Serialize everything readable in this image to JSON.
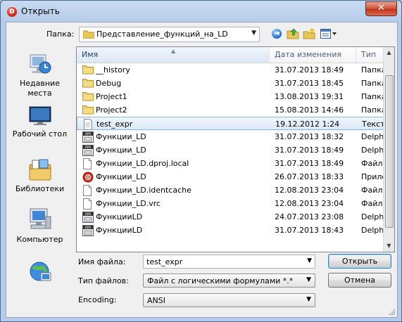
{
  "window": {
    "title": "Открыть",
    "close_glyph": "✕",
    "app_icon_letter": "D"
  },
  "toolbar": {
    "look_in_label": "Папка:",
    "look_in_value": "Представление_функций_на_LD"
  },
  "places": [
    {
      "label1": "Недавние",
      "label2": "места",
      "icon": "recent-places-icon"
    },
    {
      "label1": "Рабочий стол",
      "label2": "",
      "icon": "desktop-icon"
    },
    {
      "label1": "Библиотеки",
      "label2": "",
      "icon": "libraries-icon"
    },
    {
      "label1": "Компьютер",
      "label2": "",
      "icon": "computer-icon"
    },
    {
      "label1": "",
      "label2": "",
      "icon": "network-icon"
    }
  ],
  "columns": {
    "name": "Имя",
    "date": "Дата изменения",
    "type": "Тип"
  },
  "files": [
    {
      "name": "__history",
      "date": "31.07.2013 18:49",
      "type": "Папка",
      "icon": "folder"
    },
    {
      "name": "Debug",
      "date": "31.07.2013 18:45",
      "type": "Папка",
      "icon": "folder"
    },
    {
      "name": "Project1",
      "date": "13.08.2013 19:31",
      "type": "Папка",
      "icon": "folder"
    },
    {
      "name": "Project2",
      "date": "15.08.2013 14:46",
      "type": "Папка",
      "icon": "folder"
    },
    {
      "name": "test_expr",
      "date": "19.12.2012 1:24",
      "type": "Текстов",
      "icon": "text",
      "selected": true
    },
    {
      "name": "Функции_LD",
      "date": "31.07.2013 18:32",
      "type": "Delphi",
      "icon": "delphi"
    },
    {
      "name": "Функции_LD",
      "date": "31.07.2013 18:49",
      "type": "Delphi",
      "icon": "delphi"
    },
    {
      "name": "Функции_LD.dproj.local",
      "date": "31.07.2013 18:49",
      "type": "Файл '",
      "icon": "doc"
    },
    {
      "name": "Функции_LD",
      "date": "26.07.2013 18:33",
      "type": "Прилож",
      "icon": "app"
    },
    {
      "name": "Функции_LD.identcache",
      "date": "12.08.2013 23:04",
      "type": "Файл '",
      "icon": "doc"
    },
    {
      "name": "Функции_LD.vrc",
      "date": "12.08.2013 23:04",
      "type": "Файл '",
      "icon": "doc"
    },
    {
      "name": "ФункцииLD",
      "date": "24.07.2013 23:08",
      "type": "Delphi",
      "icon": "delphi"
    },
    {
      "name": "ФункцииLD",
      "date": "31.07.2013 18:43",
      "type": "Delphi",
      "icon": "delphi"
    }
  ],
  "form": {
    "filename_label": "Имя файла:",
    "filename_value": "test_expr",
    "filetype_label": "Тип файлов:",
    "filetype_value": "Файл с логическими формулами *.*",
    "encoding_label": "Encoding:",
    "encoding_value": "ANSI",
    "open_button": "Открыть",
    "cancel_button": "Отмена"
  }
}
